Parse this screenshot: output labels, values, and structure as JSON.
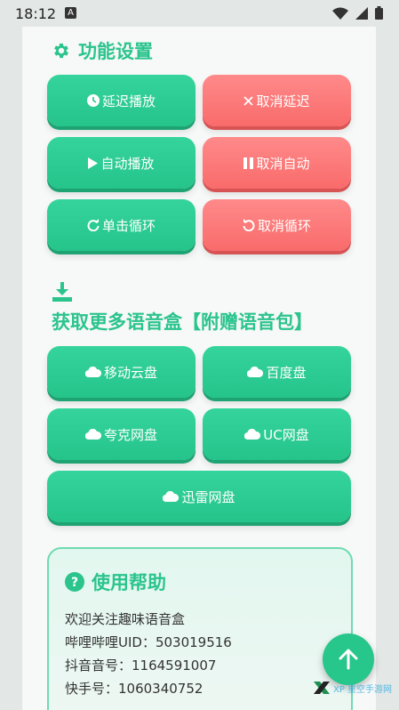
{
  "status_bar": {
    "time": "18:12",
    "notification_icon": "A"
  },
  "features": {
    "title": "功能设置",
    "buttons": [
      {
        "label": "延迟播放",
        "icon": "clock-icon",
        "color": "#2bc48d"
      },
      {
        "label": "取消延迟",
        "icon": "x-icon",
        "color": "#f96b6b"
      },
      {
        "label": "自动播放",
        "icon": "play-icon",
        "color": "#2bc48d"
      },
      {
        "label": "取消自动",
        "icon": "pause-icon",
        "color": "#f96b6b"
      },
      {
        "label": "单击循环",
        "icon": "redo-icon",
        "color": "#2bc48d"
      },
      {
        "label": "取消循环",
        "icon": "undo-icon",
        "color": "#f96b6b"
      }
    ]
  },
  "download": {
    "title": "获取更多语音盒【附赠语音包】",
    "buttons": [
      {
        "label": "移动云盘",
        "icon": "cloud-icon"
      },
      {
        "label": "百度盘",
        "icon": "cloud-icon"
      },
      {
        "label": "夸克网盘",
        "icon": "cloud-icon"
      },
      {
        "label": "UC网盘",
        "icon": "cloud-icon"
      },
      {
        "label": "迅雷网盘",
        "icon": "cloud-icon"
      }
    ]
  },
  "help": {
    "title": "使用帮助",
    "lines": [
      "欢迎关注趣味语音盒",
      "哔哩哔哩UID：503019516",
      "抖音音号：1164591007",
      "快手号：1060340752"
    ]
  },
  "watermark": "XP 星空手游网",
  "colors": {
    "accent": "#2bc48d",
    "danger": "#f96b6b",
    "background": "#f7f8f8"
  }
}
